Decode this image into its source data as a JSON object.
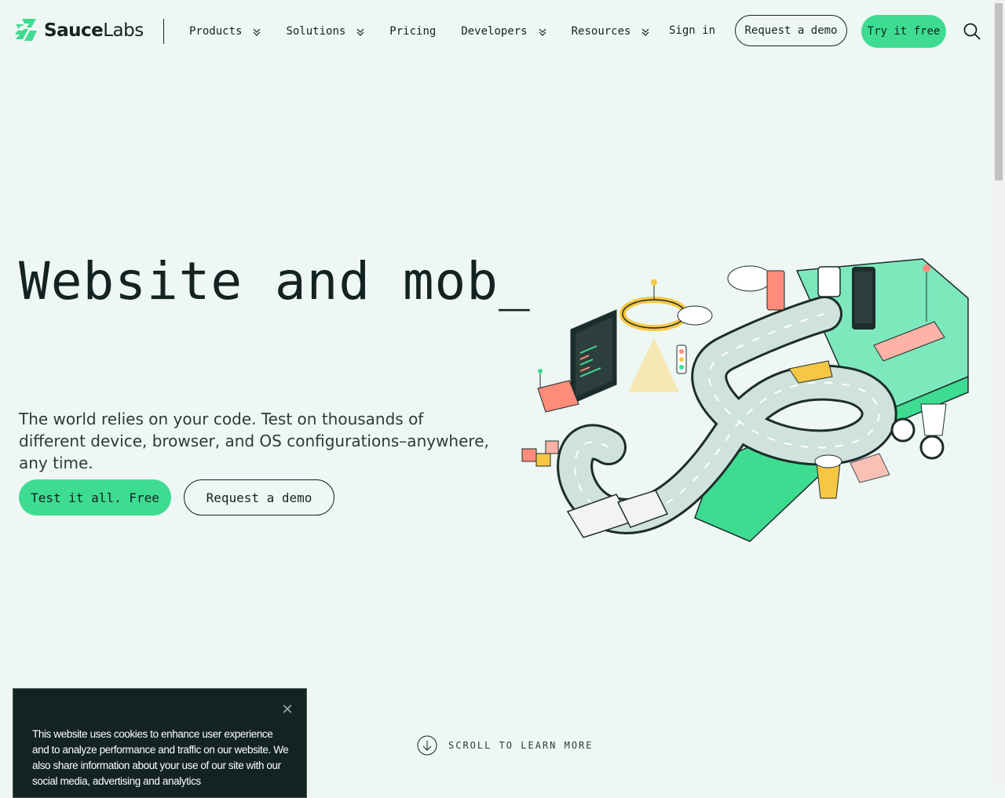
{
  "brand": {
    "name_bold": "Sauce",
    "name_light": "Labs",
    "accent": "#3ddc91",
    "text_color": "#132322",
    "bg": "#eef7f4"
  },
  "nav": {
    "items": [
      {
        "label": "Products",
        "has_dropdown": true
      },
      {
        "label": "Solutions",
        "has_dropdown": true
      },
      {
        "label": "Pricing",
        "has_dropdown": false
      },
      {
        "label": "Developers",
        "has_dropdown": true
      },
      {
        "label": "Resources",
        "has_dropdown": true
      }
    ],
    "sign_in": "Sign in",
    "request_demo": "Request a demo",
    "try_free": "Try it free",
    "search_icon": "search-icon"
  },
  "hero": {
    "title": "Website and mob_",
    "subtitle": "The world relies on your code. Test on thousands of different device, browser, and OS configurations–anywhere, any time.",
    "primary_cta": "Test it all. Free",
    "secondary_cta": "Request a demo"
  },
  "scroll_hint": "SCROLL TO LEARN MORE",
  "cookie": {
    "text": "This website uses cookies to enhance user experience and to analyze performance and traffic on our website. We also share information about your use of our site with our social media, advertising and analytics",
    "close_icon": "close-icon"
  }
}
